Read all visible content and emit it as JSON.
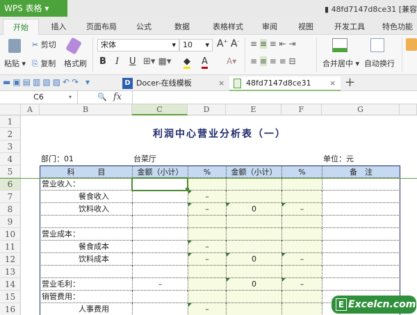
{
  "app": {
    "name": "WPS 表格",
    "doc_title": "48fd7147d8ce31 [兼容"
  },
  "menu_tabs": [
    "开始",
    "插入",
    "页面布局",
    "公式",
    "数据",
    "表格样式",
    "审阅",
    "视图",
    "开发工具",
    "特色功能"
  ],
  "ribbon": {
    "paste": "粘贴",
    "cut": "剪切",
    "copy": "复制",
    "format_painter": "格式刷",
    "font": "宋体",
    "size": "10",
    "merge_center": "合并居中",
    "wrap_text": "自动换行",
    "bold": "B",
    "italic": "I",
    "underline": "U"
  },
  "doc_tabs": [
    {
      "label": "Docer-在线模板"
    },
    {
      "label": "48fd7147d8ce31"
    }
  ],
  "formula_bar": {
    "name_box": "C6",
    "fx": "fx",
    "value": ""
  },
  "columns": [
    "A",
    "B",
    "C",
    "D",
    "E",
    "F",
    "G"
  ],
  "selected_cell": "C6",
  "sheet": {
    "title": "利润中心营业分析表（一）",
    "rows": [
      {
        "n": "1"
      },
      {
        "n": "2"
      },
      {
        "n": "3"
      },
      {
        "n": "4",
        "B": "部门：01",
        "C": "台菜厅",
        "G": "单位：元"
      },
      {
        "n": "5",
        "B": "科　　　目",
        "C": "金额（小计）",
        "D": "%",
        "E": "金额（小计）",
        "F": "%",
        "G": "备　注"
      },
      {
        "n": "6",
        "B": "营业收入："
      },
      {
        "n": "7",
        "B": "餐食收入",
        "indent": true,
        "D": "–"
      },
      {
        "n": "8",
        "B": "饮料收入",
        "indent": true,
        "D": "–",
        "E": "0",
        "F": "–"
      },
      {
        "n": "9"
      },
      {
        "n": "10",
        "B": "营业成本："
      },
      {
        "n": "11",
        "B": "餐食成本",
        "indent": true,
        "D": "–"
      },
      {
        "n": "12",
        "B": "饮料成本",
        "indent": true,
        "D": "–",
        "E": "0",
        "F": "–"
      },
      {
        "n": "13"
      },
      {
        "n": "14",
        "B": "营业毛利：",
        "C": "–",
        "E": "0",
        "F": "–"
      },
      {
        "n": "15",
        "B": "销管费用："
      },
      {
        "n": "16",
        "B": "人事费用",
        "indent": true,
        "D": "–"
      }
    ]
  },
  "watermark": "Excelcn.com",
  "colors": {
    "header_fill": "#c5d9f1",
    "yellow_fill": "#f7fbe1",
    "title": "#1f2a6b",
    "accent": "#4da33b"
  }
}
